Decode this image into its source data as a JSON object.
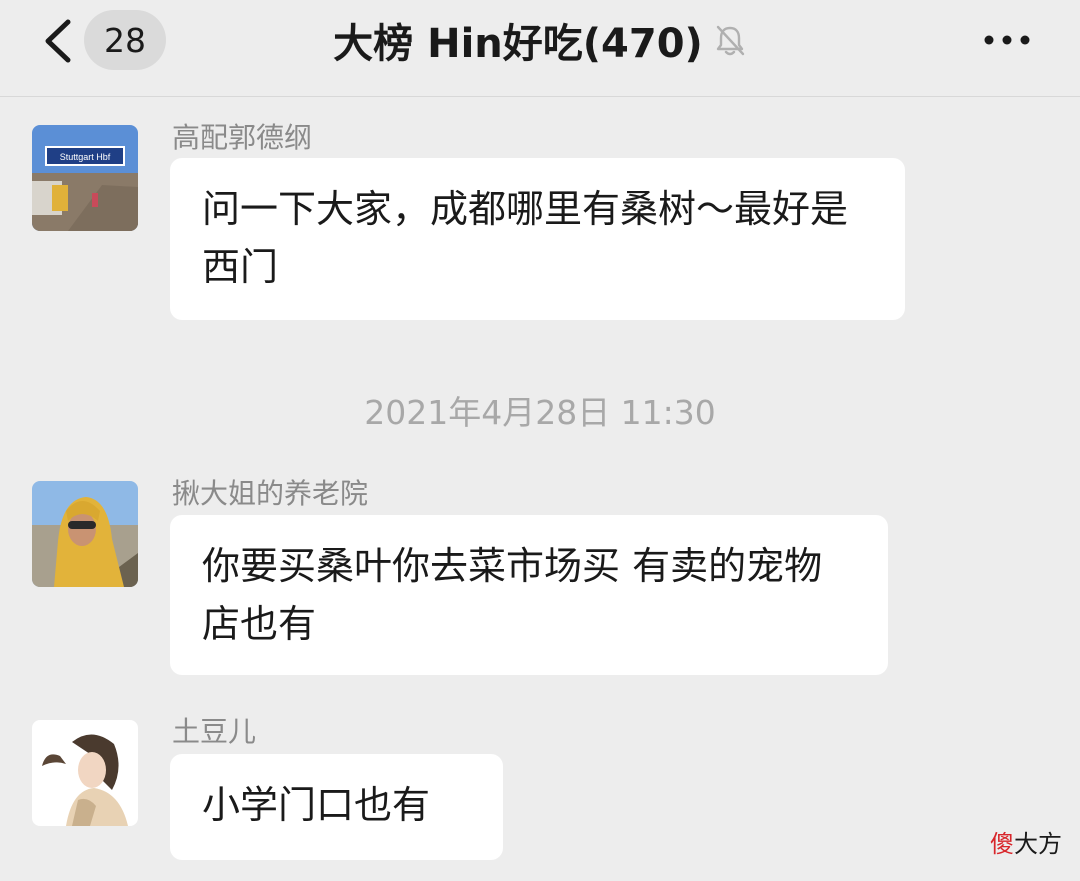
{
  "header": {
    "unread_count": "28",
    "title": "大榜 Hin好吃(470)"
  },
  "messages": [
    {
      "sender": "高配郭德纲",
      "avatar_text": "Stuttgart Hbf",
      "text": "问一下大家，成都哪里有桑树～最好是西门"
    },
    {
      "sender": "揪大姐的养老院",
      "text": "你要买桑叶你去菜市场买 有卖的宠物店也有"
    },
    {
      "sender": "土豆儿",
      "text": "小学门口也有"
    }
  ],
  "timestamp": "2021年4月28日 11:30",
  "watermark": {
    "part1": "傻",
    "part2": "大方"
  },
  "colors": {
    "background": "#ededed",
    "bubble": "#ffffff",
    "sender": "#8a8a8a",
    "timestamp": "#a8a8a8",
    "watermark_accent": "#d8262b"
  },
  "icons": [
    "back-chevron-icon",
    "mute-bell-icon",
    "more-dots-icon"
  ]
}
